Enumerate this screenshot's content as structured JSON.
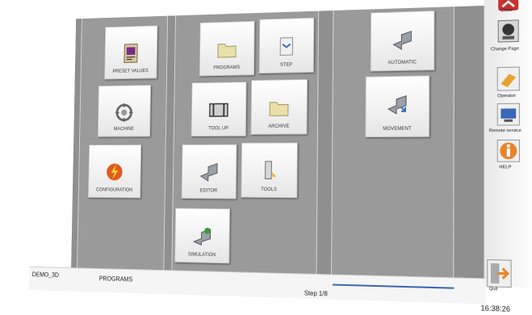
{
  "colors": {
    "panel_dark": "#8c8c8c",
    "panel_light": "#a4a4a4",
    "tile": "#f2f2f2",
    "status_bar": "#f5f5f5",
    "accent_blue": "#3a68b8",
    "accent_orange": "#e8842a",
    "close_red": "#c8302c"
  },
  "tiles": {
    "preset_values": {
      "label": "PRESET VALUES",
      "icon": "preset-values-icon"
    },
    "machine": {
      "label": "MACHINE",
      "icon": "machine-icon"
    },
    "configuration": {
      "label": "CONFIGURATION",
      "icon": "configuration-icon"
    },
    "programs": {
      "label": "PROGRAMS",
      "icon": "folder-icon"
    },
    "step": {
      "label": "STEP",
      "icon": "step-icon"
    },
    "tool_up": {
      "label": "TOOL UP",
      "icon": "tool-up-icon"
    },
    "archive": {
      "label": "ARCHIVE",
      "icon": "archive-folder-icon"
    },
    "editor": {
      "label": "EDITOR",
      "icon": "editor-icon"
    },
    "tools": {
      "label": "TOOLS",
      "icon": "tools-icon"
    },
    "simulation": {
      "label": "SIMULATION",
      "icon": "simulation-icon"
    },
    "automatic": {
      "label": "AUTOMATIC",
      "icon": "automatic-icon"
    },
    "movement": {
      "label": "MOVEMENT",
      "icon": "movement-icon"
    }
  },
  "sidebar": {
    "close": {
      "label": "Close",
      "icon": "close-icon"
    },
    "change_page": {
      "label": "Change Page",
      "icon": "change-page-icon"
    },
    "operator": {
      "label": "Operator",
      "icon": "operator-icon"
    },
    "remote_service": {
      "label": "Remote service",
      "icon": "remote-service-icon"
    },
    "help": {
      "label": "HELP",
      "icon": "help-icon"
    },
    "quit": {
      "label": "Quit",
      "icon": "quit-icon"
    }
  },
  "status_bar": {
    "machine_name": "DEMO_3D",
    "page_name": "PROGRAMS",
    "step_counter": "Step 1/8",
    "clock": "16:38:26"
  }
}
